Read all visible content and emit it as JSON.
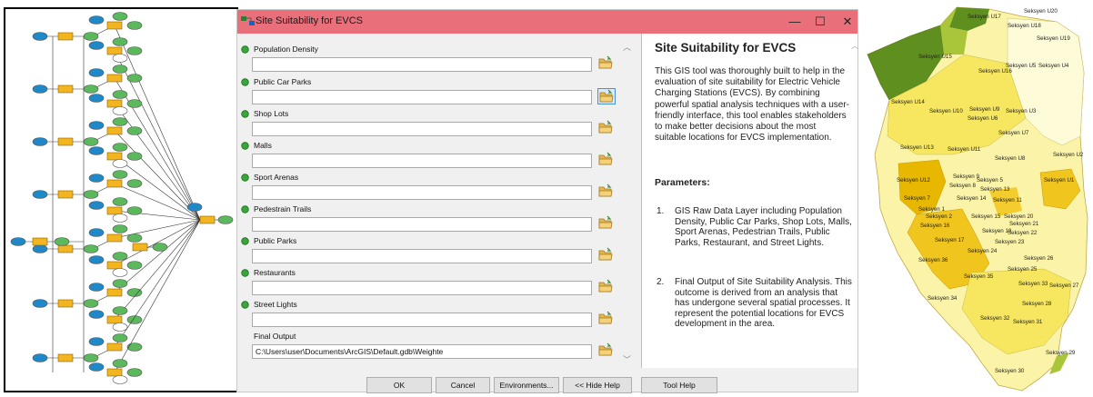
{
  "dialog": {
    "title": "Site Suitability for EVCS",
    "controls": {
      "minimize": "—",
      "maximize": "☐",
      "close": "✕"
    },
    "parameters": [
      {
        "label": "Population Density",
        "value": ""
      },
      {
        "label": "Public Car Parks",
        "value": ""
      },
      {
        "label": "Shop Lots",
        "value": ""
      },
      {
        "label": "Malls",
        "value": ""
      },
      {
        "label": "Sport Arenas",
        "value": ""
      },
      {
        "label": "Pedestrain Trails",
        "value": ""
      },
      {
        "label": "Public Parks",
        "value": ""
      },
      {
        "label": "Restaurants",
        "value": ""
      },
      {
        "label": "Street Lights",
        "value": ""
      }
    ],
    "final_output": {
      "label": "Final Output",
      "value": "C:\\Users\\user\\Documents\\ArcGIS\\Default.gdb\\Weighte"
    },
    "buttons": {
      "ok": "OK",
      "cancel": "Cancel",
      "environments": "Environments...",
      "hide_help": "<< Hide Help",
      "tool_help": "Tool Help"
    }
  },
  "help": {
    "title": "Site Suitability for EVCS",
    "body": "This GIS tool was thoroughly built to help in the evaluation of site suitability for Electric Vehicle Charging Stations (EVCS). By combining powerful spatial analysis techniques with a user-friendly interface, this tool enables stakeholders to make better decisions about the most suitable locations for EVCS implementation.",
    "parameters_heading": "Parameters:",
    "items": [
      {
        "num": "1.",
        "text": "GIS Raw Data Layer including Population Density, Public Car Parks, Shop Lots, Malls, Sport Arenas, Pedestrian Trails, Public Parks, Restaurant, and Street Lights."
      },
      {
        "num": "2.",
        "text": "Final Output of Site Suitability Analysis. This outcome is derived from an analysis that has undergone several spatial processes. It represent the potential locations for EVCS development in the area."
      }
    ]
  },
  "map": {
    "labels": [
      "Seksyen U20",
      "Seksyen U17",
      "Seksyen U18",
      "Seksyen U19",
      "Seksyen U15",
      "Seksyen U5",
      "Seksyen U4",
      "Seksyen U16",
      "Seksyen U14",
      "Seksyen U10",
      "Seksyen U9",
      "Seksyen U3",
      "Seksyen U6",
      "Seksyen U7",
      "Seksyen U13",
      "Seksyen U11",
      "Seksyen U8",
      "Seksyen U2",
      "Seksyen U12",
      "Seksyen 9",
      "Seksyen 5",
      "Seksyen U1",
      "Seksyen 8",
      "Seksyen 13",
      "Seksyen 7",
      "Seksyen 14",
      "Seksyen 11",
      "Seksyen 1",
      "Seksyen 2",
      "Seksyen 15",
      "Seksyen 20",
      "Seksyen 16",
      "Seksyen 21",
      "Seksyen 19",
      "Seksyen 22",
      "Seksyen 17",
      "Seksyen 23",
      "Seksyen 24",
      "Seksyen 36",
      "Seksyen 26",
      "Seksyen 25",
      "Seksyen 35",
      "Seksyen 33",
      "Seksyen 27",
      "Seksyen 34",
      "Seksyen 28",
      "Seksyen 32",
      "Seksyen 31",
      "Seksyen 29",
      "Seksyen 30"
    ],
    "colors": {
      "dark_green": "#5f8f1e",
      "light_green": "#a9c63a",
      "gold": "#e8b800",
      "yellow": "#f7e760",
      "pale_yellow": "#fbf4a8",
      "cream": "#fdfbd8"
    }
  },
  "model": {
    "colors": {
      "input": "#1e88c9",
      "tool": "#f2b51f",
      "output": "#5cb85c",
      "empty": "#ffffff"
    }
  }
}
